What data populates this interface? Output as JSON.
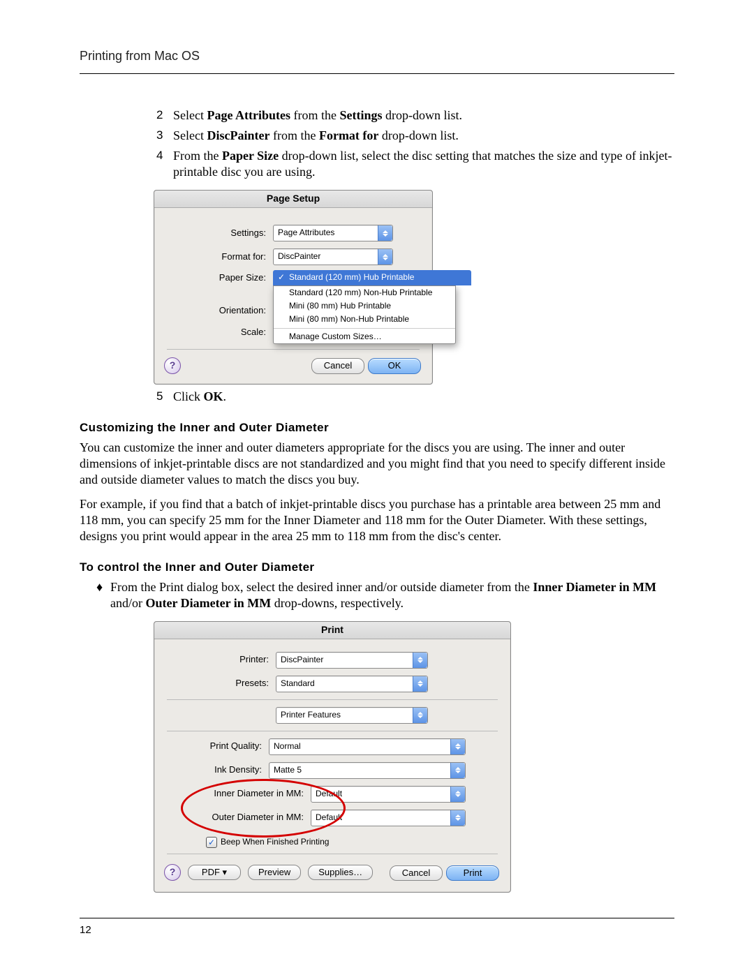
{
  "header": {
    "title": "Printing from Mac OS"
  },
  "steps": {
    "s2": {
      "num": "2",
      "a": "Select ",
      "b": "Page Attributes",
      "c": " from the ",
      "d": "Settings",
      "e": " drop-down list."
    },
    "s3": {
      "num": "3",
      "a": "Select ",
      "b": "DiscPainter",
      "c": " from the ",
      "d": "Format for",
      "e": " drop-down list."
    },
    "s4": {
      "num": "4",
      "a": "From the ",
      "b": "Paper Size",
      "c": " drop-down list, select the disc setting that matches the size and type of inkjet-printable disc you are using."
    },
    "s5": {
      "num": "5",
      "a": "Click ",
      "b": "OK",
      "c": "."
    }
  },
  "dlg1": {
    "title": "Page Setup",
    "settings_label": "Settings:",
    "settings_value": "Page Attributes",
    "format_label": "Format for:",
    "format_value": "DiscPainter",
    "papersize_label": "Paper Size:",
    "orientation_label": "Orientation:",
    "scale_label": "Scale:",
    "dd": {
      "sel": "Standard (120 mm) Hub Printable",
      "o1": "Standard (120 mm) Non-Hub Printable",
      "o2": "Mini (80 mm) Hub Printable",
      "o3": "Mini (80 mm) Non-Hub Printable",
      "o4": "Manage Custom Sizes…"
    },
    "help": "?",
    "cancel": "Cancel",
    "ok": "OK"
  },
  "sec1": {
    "title": "Customizing the Inner and Outer Diameter"
  },
  "para1": "You can customize the inner and outer diameters appropriate for the discs you are using. The inner and outer dimensions of inkjet-printable discs are not standardized and you might find that you need to specify different inside and outside diameter values to match the discs you buy.",
  "para2": "For example, if you find that a batch of inkjet-printable discs you purchase has a printable area between 25 mm and 118 mm, you can specify 25 mm for the Inner Diameter and 118 mm for the Outer Diameter. With these settings, designs you print would appear in the area 25 mm to 118 mm from the disc's center.",
  "sec2": {
    "title": "To control the Inner and Outer Diameter"
  },
  "bullet1": {
    "diamond": "♦",
    "a": "From the Print dialog box, select the desired inner and/or outside diameter from the ",
    "b": "Inner Diameter in MM",
    "c": " and/or ",
    "d": "Outer Diameter in MM",
    "e": " drop-downs, respectively."
  },
  "dlg2": {
    "title": "Print",
    "printer_label": "Printer:",
    "printer_value": "DiscPainter",
    "presets_label": "Presets:",
    "presets_value": "Standard",
    "features_value": "Printer Features",
    "pq_label": "Print Quality:",
    "pq_value": "Normal",
    "ink_label": "Ink Density:",
    "ink_value": "Matte 5",
    "inner_label": "Inner Diameter in MM:",
    "inner_value": "Default",
    "outer_label": "Outer Diameter in MM:",
    "outer_value": "Default",
    "beep_label": "Beep When Finished Printing",
    "help": "?",
    "pdf": "PDF ▾",
    "preview": "Preview",
    "supplies": "Supplies…",
    "cancel": "Cancel",
    "print": "Print"
  },
  "footer": {
    "page": "12"
  }
}
